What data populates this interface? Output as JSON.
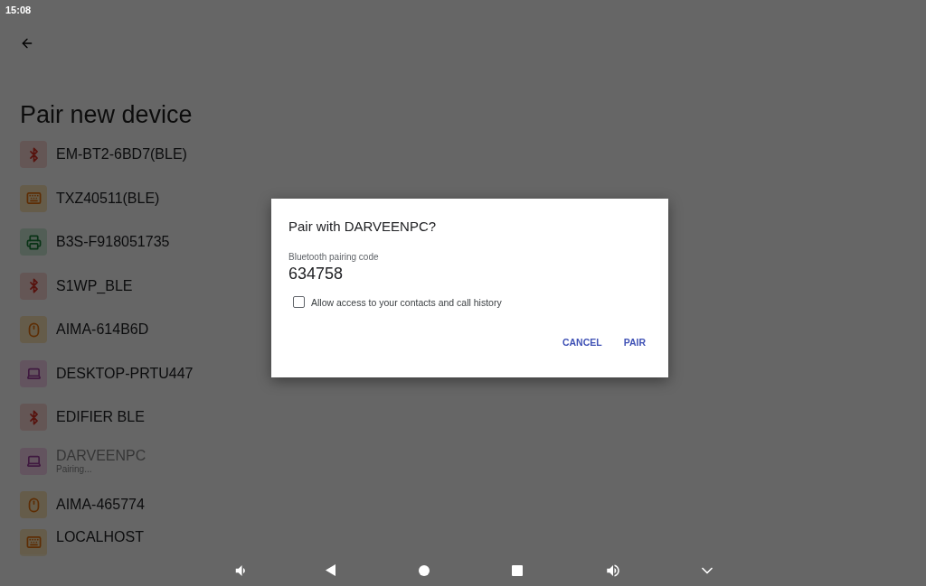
{
  "status_bar": {
    "time": "15:08"
  },
  "title": "Pair new device",
  "devices": [
    {
      "kind": "bluetooth",
      "name": "EM-BT2-6BD7(BLE)",
      "disabled": false
    },
    {
      "kind": "keyboard",
      "name": "TXZ40511(BLE)",
      "disabled": false
    },
    {
      "kind": "printer",
      "name": "B3S-F918051735",
      "disabled": false
    },
    {
      "kind": "bluetooth",
      "name": "S1WP_BLE",
      "disabled": false
    },
    {
      "kind": "mouse",
      "name": "AIMA-614B6D",
      "disabled": false
    },
    {
      "kind": "laptop",
      "name": "DESKTOP-PRTU447",
      "disabled": false
    },
    {
      "kind": "bluetooth",
      "name": "EDIFIER BLE",
      "disabled": false
    },
    {
      "kind": "laptop",
      "name": "DARVEENPC",
      "subtitle": "Pairing...",
      "disabled": true
    },
    {
      "kind": "mouse",
      "name": "AIMA-465774",
      "disabled": false
    },
    {
      "kind": "keyboard",
      "name": "LOCALHOST",
      "disabled": false
    }
  ],
  "dialog": {
    "title": "Pair with DARVEENPC?",
    "code_label": "Bluetooth pairing code",
    "code": "634758",
    "checkbox": {
      "label": "Allow access to your contacts and call history",
      "checked": false
    },
    "buttons": [
      "CANCEL",
      "PAIR"
    ]
  },
  "nav_bar": [
    {
      "kind": "volume-down"
    },
    {
      "kind": "back"
    },
    {
      "kind": "home"
    },
    {
      "kind": "recents"
    },
    {
      "kind": "volume-up"
    },
    {
      "kind": "collapse"
    }
  ]
}
